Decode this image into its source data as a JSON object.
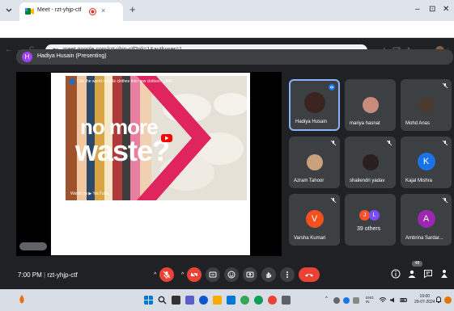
{
  "browser": {
    "tab_title": "Meet - rzt-yhjp-ctf",
    "tab_close": "×",
    "new_tab": "+",
    "url": "meet.google.com/rzt-yhjp-ctf?pli=1&authuser=1",
    "min_glyph": "–",
    "max_glyph": "⊡",
    "close_glyph": "✕",
    "back_glyph": "←",
    "fwd_glyph": "→",
    "reload_glyph": "C"
  },
  "meet": {
    "presenter_initial": "H",
    "presenter_label": "Hadiya Husain (Presenting)",
    "video": {
      "channel_title": "Can the world recycle clothes into new clothes? | BBC",
      "line1": "no more",
      "line2": "waste?",
      "watch_on": "Watch on ▶ YouTube"
    },
    "participants": [
      {
        "name": "Hadiya Husain",
        "type": "photo"
      },
      {
        "name": "mariya hasnat",
        "type": "photo"
      },
      {
        "name": "Mohd Anas",
        "type": "photo"
      },
      {
        "name": "Azram Tahoor",
        "type": "photo"
      },
      {
        "name": "shailendri yadav",
        "type": "photo"
      },
      {
        "name": "Kajal Mishra",
        "type": "letter",
        "initial": "K",
        "color": "#1a73e8"
      },
      {
        "name": "Varsha Kumari",
        "type": "letter",
        "initial": "V",
        "color": "#f4511e"
      },
      {
        "name": "39 others",
        "type": "others",
        "initials": [
          "J",
          "L"
        ]
      },
      {
        "name": "Ambrina Sardar...",
        "type": "letter",
        "initial": "A",
        "color": "#9c27b0"
      }
    ],
    "controls": {
      "time": "7:00 PM",
      "separator": "|",
      "meeting_code": "rzt-yhjp-ctf",
      "caret": "^",
      "people_count": "48"
    }
  },
  "taskbar": {
    "lang_top": "ENG",
    "lang_bottom": "IN",
    "clock_time": "19:00",
    "clock_date": "29-07-2024",
    "tray_up": "^"
  },
  "colors": {
    "accent": "#8ab4f8",
    "end_call": "#ea4335",
    "pink": "#e0245e"
  }
}
